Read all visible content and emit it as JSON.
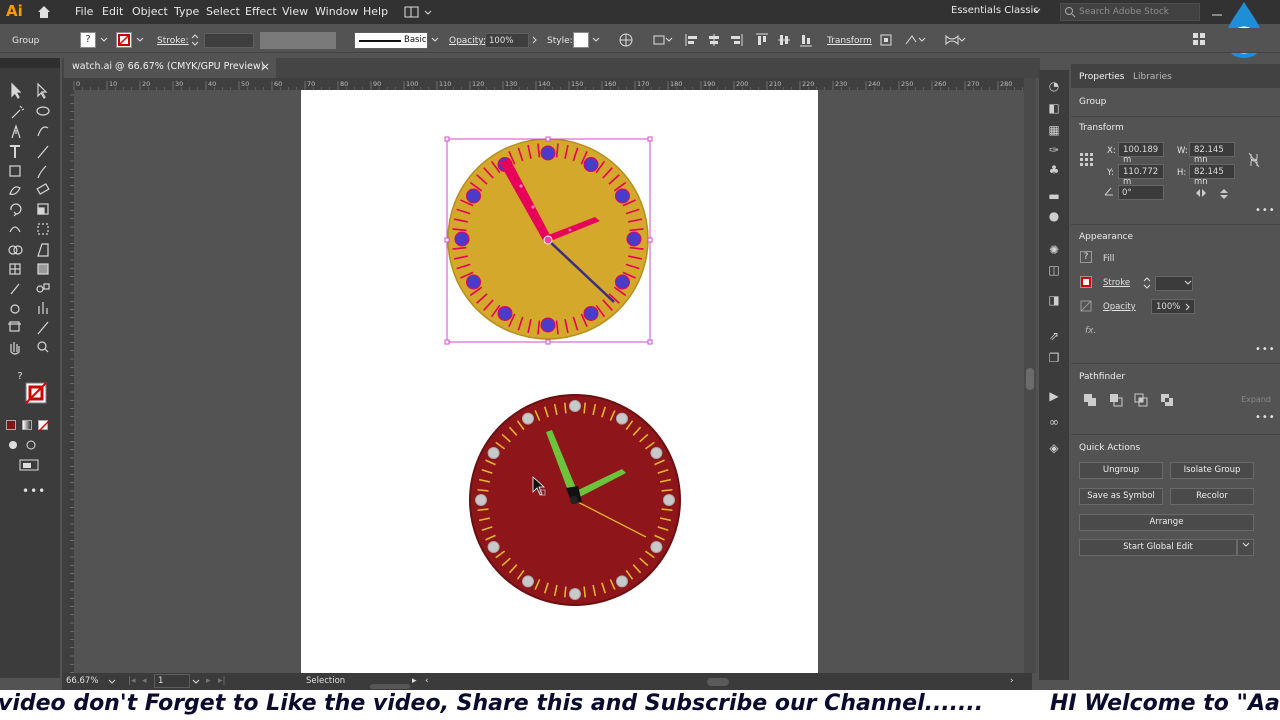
{
  "app": {
    "logo": "Ai",
    "workspace": "Essentials Classic",
    "search_placeholder": "Search Adobe Stock"
  },
  "menu": [
    "File",
    "Edit",
    "Object",
    "Type",
    "Select",
    "Effect",
    "View",
    "Window",
    "Help"
  ],
  "control_bar": {
    "selection": "Group",
    "stroke_label": "Stroke:",
    "brush_label": "Basic",
    "opacity_label": "Opacity:",
    "opacity_value": "100%",
    "style_label": "Style:",
    "transform_label": "Transform"
  },
  "document_tab": {
    "title": "watch.ai @ 66.67% (CMYK/GPU Preview)",
    "close": "×"
  },
  "ruler": {
    "labels": [
      "0",
      "10",
      "20",
      "30",
      "40",
      "50",
      "60",
      "70",
      "80",
      "90",
      "100",
      "110",
      "120",
      "130",
      "140",
      "150",
      "160",
      "170",
      "180",
      "190",
      "200",
      "210",
      "220",
      "230",
      "240",
      "250",
      "260",
      "270",
      "280",
      "290",
      "300"
    ]
  },
  "panel": {
    "tabs": [
      "Properties",
      "Libraries"
    ],
    "selection_type": "Group",
    "transform": {
      "title": "Transform",
      "x_label": "X:",
      "x_value": "100.189 m",
      "y_label": "Y:",
      "y_value": "110.772 m",
      "w_label": "W:",
      "w_value": "82.145 mn",
      "h_label": "H:",
      "h_value": "82.145 mn",
      "angle_value": "0°"
    },
    "appearance": {
      "title": "Appearance",
      "fill_label": "Fill",
      "stroke_label": "Stroke",
      "opacity_label": "Opacity",
      "opacity_value": "100%",
      "fx_label": "fx."
    },
    "pathfinder": {
      "title": "Pathfinder",
      "expand_label": "Expand"
    },
    "quick_actions": {
      "title": "Quick Actions",
      "ungroup": "Ungroup",
      "isolate": "Isolate Group",
      "save_symbol": "Save as Symbol",
      "recolor": "Recolor",
      "arrange": "Arrange",
      "global_edit": "Start Global Edit"
    }
  },
  "status": {
    "zoom": "66.67%",
    "artboard": "1",
    "tool": "Selection"
  },
  "ticker": {
    "left_text": "video don't Forget to Like the video, Share this and Subscribe our Channel.......",
    "right_text": "HI Welcome to \"Aam"
  },
  "colors": {
    "clock1_face": "#d4a82a",
    "clock1_marker": "#4a3cc8",
    "clock1_hand": "#e6005a",
    "clock2_face": "#8e1519",
    "clock2_marker": "#c9c9c9",
    "clock2_hand": "#6bc43c",
    "selection": "#d24ad2",
    "ai_orange": "#ff9a00"
  }
}
